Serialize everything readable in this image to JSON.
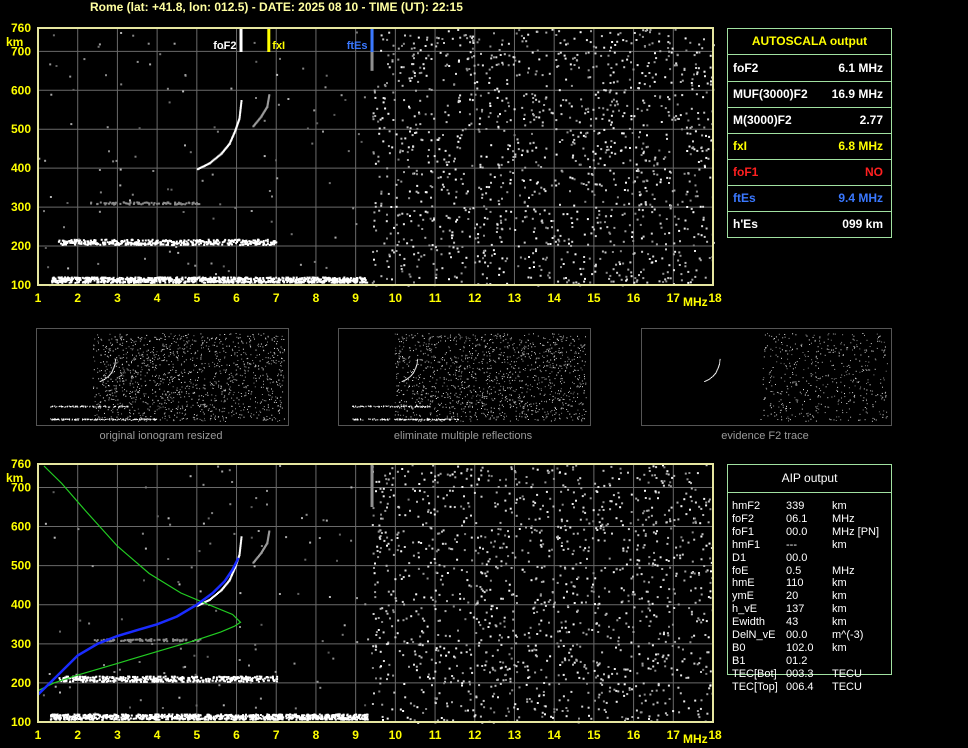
{
  "header": {
    "text": "Rome (lat: +41.8, lon: 012.5) - DATE: 2025 08 10 - TIME (UT): 22:15"
  },
  "colors": {
    "grid": "#6a6a6a",
    "frame": "#e6e6a0",
    "axis_text": "#ffff00",
    "trace": "#ffffff",
    "fof2": "#ffffff",
    "fxi": "#ffff00",
    "ftes": "#3a78ff",
    "profile_green": "#22cc22",
    "profile_blue": "#1a2cff",
    "panel_border": "#a0e0a0"
  },
  "markers": [
    {
      "label": "foF2",
      "freq": 6.1,
      "color": "#ffffff"
    },
    {
      "label": "fxI",
      "freq": 6.8,
      "color": "#ffff00"
    },
    {
      "label": "ftEs",
      "freq": 9.4,
      "color": "#3a78ff"
    }
  ],
  "autoscala": {
    "title": "AUTOSCALA output",
    "rows": [
      {
        "name": "foF2",
        "value": "6.1 MHz",
        "name_color": "#ffffff",
        "value_color": "#ffffff"
      },
      {
        "name": "MUF(3000)F2",
        "value": "16.9 MHz",
        "name_color": "#ffffff",
        "value_color": "#ffffff"
      },
      {
        "name": "M(3000)F2",
        "value": "2.77",
        "name_color": "#ffffff",
        "value_color": "#ffffff"
      },
      {
        "name": "fxI",
        "value": "6.8 MHz",
        "name_color": "#ffff00",
        "value_color": "#ffff00"
      },
      {
        "name": "foF1",
        "value": "NO",
        "name_color": "#ff2020",
        "value_color": "#ff2020"
      },
      {
        "name": "ftEs",
        "value": "9.4 MHz",
        "name_color": "#3a78ff",
        "value_color": "#3a78ff"
      },
      {
        "name": "h'Es",
        "value": "099    km",
        "name_color": "#ffffff",
        "value_color": "#ffffff"
      }
    ]
  },
  "thumbnails": [
    {
      "caption": "original ionogram resized"
    },
    {
      "caption": "eliminate multiple reflections"
    },
    {
      "caption": "evidence F2 trace"
    }
  ],
  "aip": {
    "title": "AIP output",
    "rows": [
      {
        "name": "hmF2",
        "value": "339",
        "unit": "km"
      },
      {
        "name": "foF2",
        "value": "06.1",
        "unit": "MHz"
      },
      {
        "name": "foF1",
        "value": "00.0",
        "unit": "MHz    [PN]"
      },
      {
        "name": "hmF1",
        "value": "---",
        "unit": "km"
      },
      {
        "name": "D1",
        "value": "00.0",
        "unit": ""
      },
      {
        "name": "foE",
        "value": "0.5",
        "unit": "MHz"
      },
      {
        "name": "hmE",
        "value": "110",
        "unit": "km"
      },
      {
        "name": "ymE",
        "value": "20",
        "unit": "km"
      },
      {
        "name": "h_vE",
        "value": "137",
        "unit": "km"
      },
      {
        "name": "Ewidth",
        "value": "43",
        "unit": "km"
      },
      {
        "name": "DelN_vE",
        "value": "00.0",
        "unit": "m^(-3)"
      },
      {
        "name": "B0",
        "value": "102.0",
        "unit": "km"
      },
      {
        "name": "B1",
        "value": "01.2",
        "unit": ""
      },
      {
        "name": "TEC[Bot]",
        "value": "003.3",
        "unit": "TECU"
      },
      {
        "name": "TEC[Top]",
        "value": "006.4",
        "unit": "TECU"
      }
    ]
  },
  "chart_data": [
    {
      "type": "scatter",
      "title": "",
      "xlabel": "MHz",
      "ylabel": "km",
      "xlim": [
        1,
        18
      ],
      "ylim": [
        100,
        760
      ],
      "x_ticks": [
        1,
        2,
        3,
        4,
        5,
        6,
        7,
        8,
        9,
        10,
        11,
        12,
        13,
        14,
        15,
        16,
        17,
        18
      ],
      "y_ticks": [
        100,
        200,
        300,
        400,
        500,
        600,
        700,
        760
      ],
      "grid": true,
      "series": [
        {
          "name": "E/Es trace",
          "x": [
            1.3,
            2,
            3,
            4,
            5,
            6,
            7,
            8,
            9,
            9.3
          ],
          "y": [
            115,
            115,
            115,
            115,
            115,
            115,
            115,
            115,
            115,
            115
          ]
        },
        {
          "name": "2nd hop",
          "x": [
            1.5,
            2,
            3,
            4,
            5,
            6,
            7
          ],
          "y": [
            212,
            212,
            212,
            212,
            212,
            212,
            212
          ]
        },
        {
          "name": "F2 O-trace",
          "x": [
            5.0,
            5.3,
            5.6,
            5.8,
            5.95,
            6.05,
            6.1
          ],
          "y": [
            400,
            415,
            440,
            465,
            500,
            530,
            575
          ]
        },
        {
          "name": "F2 X-trace",
          "x": [
            6.4,
            6.6,
            6.75,
            6.8
          ],
          "y": [
            510,
            535,
            560,
            590
          ]
        }
      ]
    },
    {
      "type": "line",
      "title": "",
      "xlabel": "MHz",
      "ylabel": "km",
      "xlim": [
        1,
        18
      ],
      "ylim": [
        100,
        760
      ],
      "x_ticks": [
        1,
        2,
        3,
        4,
        5,
        6,
        7,
        8,
        9,
        10,
        11,
        12,
        13,
        14,
        15,
        16,
        17,
        18
      ],
      "y_ticks": [
        100,
        200,
        300,
        400,
        500,
        600,
        700,
        760
      ],
      "grid": true,
      "series": [
        {
          "name": "true height profile",
          "x": [
            1.0,
            1.4,
            2.0,
            3.0,
            4.0,
            5.0,
            5.6,
            5.95,
            6.1,
            5.9,
            5.3,
            4.6,
            3.8,
            3.0,
            2.2,
            1.6,
            1.15
          ],
          "y": [
            180,
            200,
            220,
            250,
            280,
            310,
            330,
            345,
            355,
            375,
            400,
            430,
            480,
            550,
            640,
            710,
            755
          ]
        },
        {
          "name": "virtual height fit",
          "x": [
            1.0,
            1.5,
            2.0,
            2.5,
            3.0,
            3.5,
            4.0,
            4.5,
            5.0,
            5.4,
            5.7,
            5.9,
            6.05
          ],
          "y": [
            170,
            220,
            270,
            300,
            320,
            335,
            350,
            370,
            400,
            430,
            460,
            490,
            520
          ]
        }
      ]
    }
  ]
}
